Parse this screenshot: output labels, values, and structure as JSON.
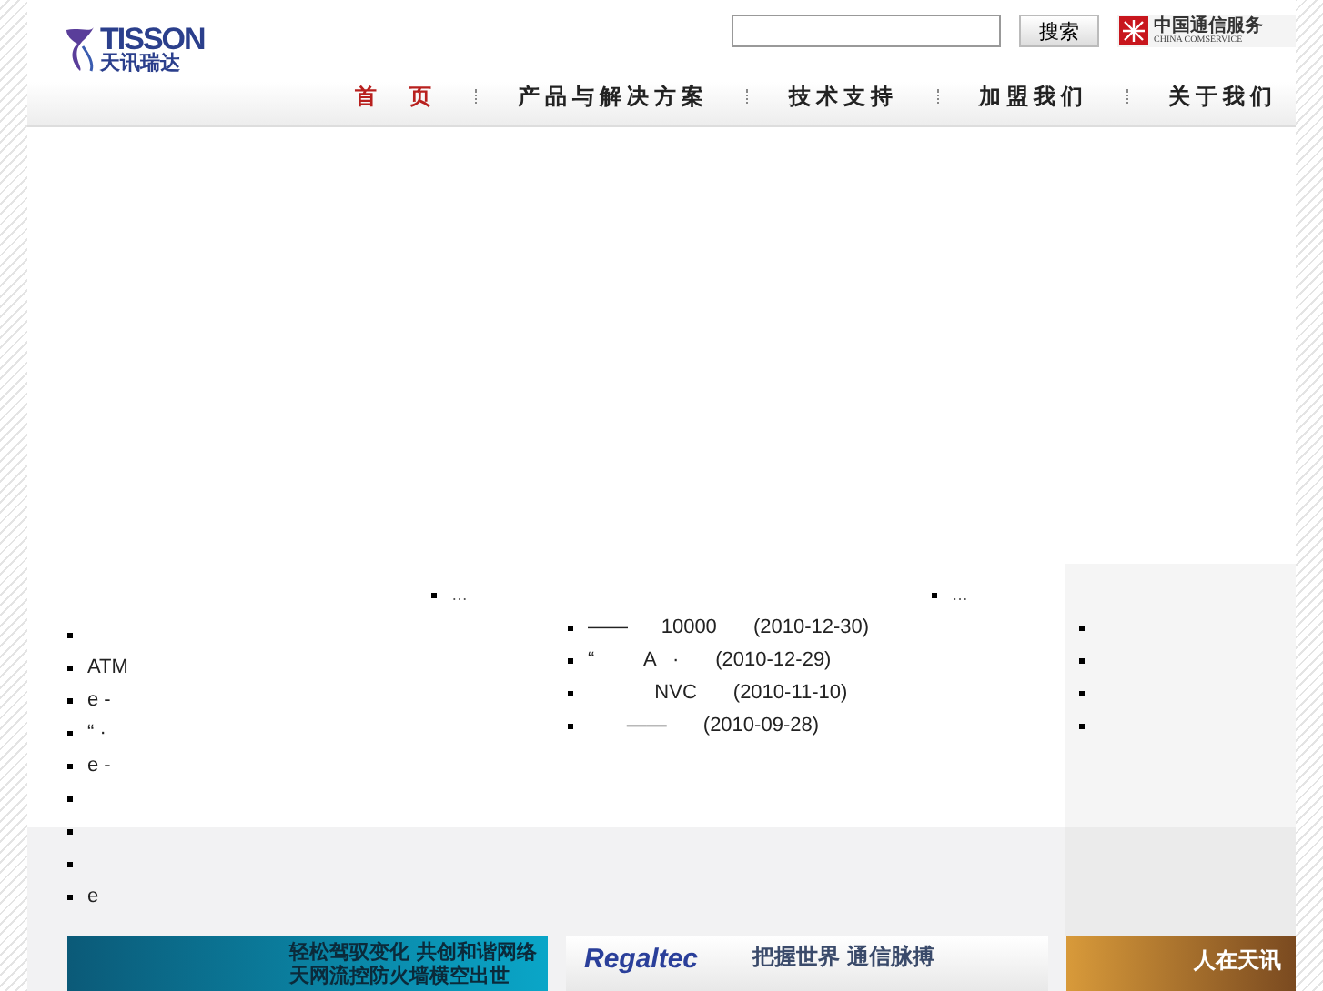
{
  "header": {
    "logo": {
      "wordmark": "TISSON",
      "name": "天讯瑞达"
    },
    "search": {
      "button": "搜索"
    },
    "partner_logo": {
      "name": "中国通信服务",
      "subtitle": "CHINA COMSERVICE"
    }
  },
  "nav": [
    {
      "label": "首　页",
      "selected": true
    },
    {
      "label": "产品与解决方案",
      "selected": false
    },
    {
      "label": "技术支持",
      "selected": false
    },
    {
      "label": "加盟我们",
      "selected": false
    },
    {
      "label": "关于我们",
      "selected": false
    }
  ],
  "left_panel": {
    "more": "…",
    "items": [
      {
        "kind": "bullet"
      },
      {
        "kind": "link",
        "text": "ATM"
      },
      {
        "kind": "link",
        "text": "e -"
      },
      {
        "kind": "link",
        "text": "“ ·"
      },
      {
        "kind": "link",
        "text": "e -"
      },
      {
        "kind": "bullet"
      },
      {
        "kind": "bullet"
      },
      {
        "kind": "bullet"
      },
      {
        "kind": "link",
        "text": "e"
      }
    ]
  },
  "news_panel": {
    "more": "…",
    "items": [
      {
        "text": "——      10000",
        "date": "(2010-12-30)"
      },
      {
        "text": "“         A   ·",
        "date": "(2010-12-29)"
      },
      {
        "text": "            NVC",
        "date": "(2010-11-10)"
      },
      {
        "text": "       ——",
        "date": "(2010-09-28)"
      }
    ]
  },
  "side_panel": {
    "items": [
      {
        "kind": "bullet"
      },
      {
        "kind": "bullet"
      },
      {
        "kind": "bullet"
      },
      {
        "kind": "bullet"
      }
    ]
  },
  "banners": [
    {
      "kind": "stars",
      "lines": [
        "轻松驾驭变化 共创和谐网络",
        "天网流控防火墙横空出世"
      ]
    },
    {
      "kind": "brand",
      "brand": "Regaltec",
      "lines": [
        "把握世界 通信脉搏"
      ]
    },
    {
      "kind": "warm",
      "lines": [
        "人在天讯"
      ]
    }
  ]
}
